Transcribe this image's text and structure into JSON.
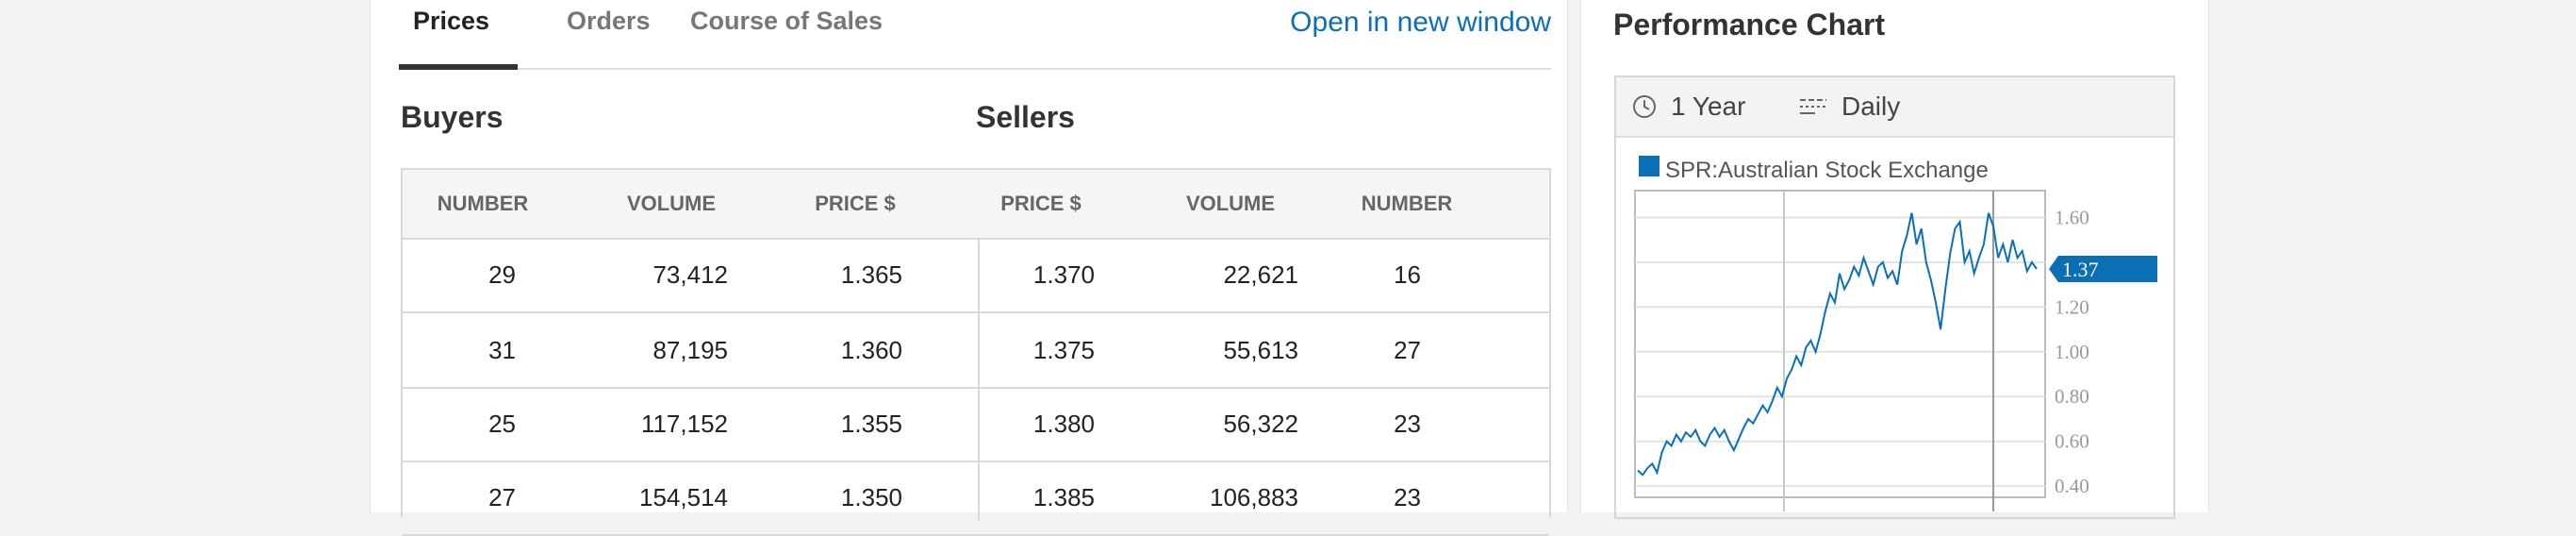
{
  "tabs": {
    "items": [
      {
        "label": "Prices",
        "active": true
      },
      {
        "label": "Orders",
        "active": false
      },
      {
        "label": "Course of Sales",
        "active": false
      }
    ],
    "open_link": "Open in new window"
  },
  "depth": {
    "buyers_heading": "Buyers",
    "sellers_heading": "Sellers",
    "columns": [
      "NUMBER",
      "VOLUME",
      "PRICE $",
      "PRICE $",
      "VOLUME",
      "NUMBER"
    ],
    "rows": [
      [
        "29",
        "73,412",
        "1.365",
        "1.370",
        "22,621",
        "16"
      ],
      [
        "31",
        "87,195",
        "1.360",
        "1.375",
        "55,613",
        "27"
      ],
      [
        "25",
        "117,152",
        "1.355",
        "1.380",
        "56,322",
        "23"
      ],
      [
        "27",
        "154,514",
        "1.350",
        "1.385",
        "106,883",
        "23"
      ]
    ]
  },
  "chart": {
    "title": "Performance Chart",
    "period_label": "1 Year",
    "interval_label": "Daily",
    "period_icon": "clock-icon",
    "interval_icon": "interval-lines-icon",
    "accent_color": "#0b6fb5"
  },
  "chart_data": {
    "type": "line",
    "series": [
      {
        "name": "SPR:Australian Stock Exchange",
        "values": [
          0.47,
          0.45,
          0.48,
          0.5,
          0.46,
          0.55,
          0.6,
          0.58,
          0.63,
          0.6,
          0.64,
          0.62,
          0.65,
          0.6,
          0.58,
          0.63,
          0.66,
          0.62,
          0.65,
          0.6,
          0.56,
          0.61,
          0.66,
          0.7,
          0.68,
          0.72,
          0.76,
          0.73,
          0.78,
          0.84,
          0.8,
          0.88,
          0.92,
          0.98,
          0.94,
          1.02,
          1.05,
          1.0,
          1.08,
          1.18,
          1.26,
          1.22,
          1.35,
          1.28,
          1.32,
          1.38,
          1.34,
          1.42,
          1.36,
          1.3,
          1.38,
          1.4,
          1.33,
          1.36,
          1.3,
          1.45,
          1.52,
          1.62,
          1.48,
          1.55,
          1.4,
          1.32,
          1.22,
          1.1,
          1.28,
          1.44,
          1.55,
          1.58,
          1.4,
          1.45,
          1.35,
          1.42,
          1.48,
          1.62,
          1.56,
          1.42,
          1.48,
          1.4,
          1.5,
          1.42,
          1.45,
          1.36,
          1.4,
          1.37
        ]
      }
    ],
    "last_value": "1.37",
    "yticks": [
      "1.60",
      "1.40",
      "1.20",
      "1.00",
      "0.80",
      "0.60",
      "0.40"
    ],
    "ylim": [
      0.35,
      1.72
    ],
    "grid": true,
    "legend": "top-left"
  }
}
